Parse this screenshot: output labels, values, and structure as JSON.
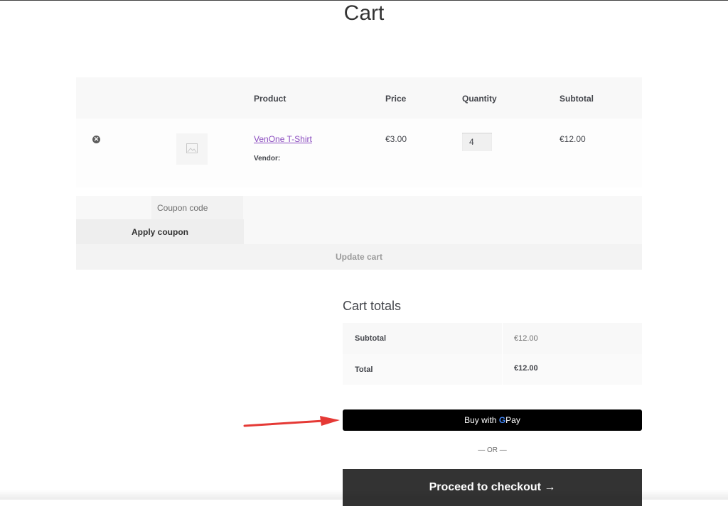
{
  "page": {
    "title": "Cart"
  },
  "cart_table": {
    "headers": {
      "product": "Product",
      "price": "Price",
      "quantity": "Quantity",
      "subtotal": "Subtotal"
    },
    "items": [
      {
        "remove_icon": "close-circle-icon",
        "thumbnail_icon": "image-placeholder-icon",
        "name": "VenOne T-Shirt",
        "vendor_label": "Vendor:",
        "price": "€3.00",
        "quantity": "4",
        "subtotal": "€12.00"
      }
    ]
  },
  "actions": {
    "coupon_placeholder": "Coupon code",
    "apply_coupon_label": "Apply coupon",
    "update_cart_label": "Update cart"
  },
  "cart_totals": {
    "title": "Cart totals",
    "subtotal_label": "Subtotal",
    "subtotal_value": "€12.00",
    "total_label": "Total",
    "total_value": "€12.00"
  },
  "payment": {
    "gpay_prefix": "Buy with",
    "gpay_brand": "Pay",
    "or_separator": "— OR —",
    "checkout_label": "Proceed to checkout →",
    "arrow_annotation_color": "#e53935"
  },
  "colors": {
    "accent_link": "#8a4bbf",
    "checkout_bg": "#333333",
    "gpay_bg": "#000000"
  }
}
